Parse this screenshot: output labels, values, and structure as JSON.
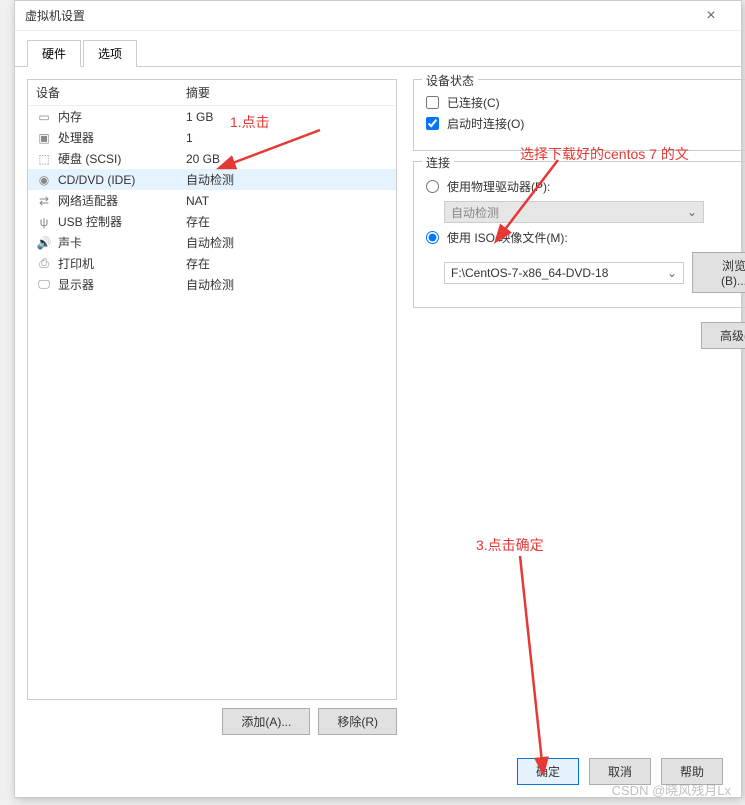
{
  "dialog": {
    "title": "虚拟机设置",
    "tabs": [
      "硬件",
      "选项"
    ],
    "active_tab": 0
  },
  "list": {
    "header_device": "设备",
    "header_summary": "摘要",
    "rows": [
      {
        "icon": "memory-icon",
        "name": "内存",
        "summary": "1 GB"
      },
      {
        "icon": "cpu-icon",
        "name": "处理器",
        "summary": "1"
      },
      {
        "icon": "disk-icon",
        "name": "硬盘 (SCSI)",
        "summary": "20 GB"
      },
      {
        "icon": "disc-icon",
        "name": "CD/DVD (IDE)",
        "summary": "自动检测"
      },
      {
        "icon": "network-icon",
        "name": "网络适配器",
        "summary": "NAT"
      },
      {
        "icon": "usb-icon",
        "name": "USB 控制器",
        "summary": "存在"
      },
      {
        "icon": "sound-icon",
        "name": "声卡",
        "summary": "自动检测"
      },
      {
        "icon": "printer-icon",
        "name": "打印机",
        "summary": "存在"
      },
      {
        "icon": "display-icon",
        "name": "显示器",
        "summary": "自动检测"
      }
    ],
    "selected_index": 3
  },
  "left_buttons": {
    "add": "添加(A)...",
    "remove": "移除(R)"
  },
  "device_status": {
    "group_title": "设备状态",
    "connected_label": "已连接(C)",
    "connected_checked": false,
    "connect_on_label": "启动时连接(O)",
    "connect_on_checked": true
  },
  "connection": {
    "group_title": "连接",
    "physical_label": "使用物理驱动器(P):",
    "physical_selected": false,
    "physical_value": "自动检测",
    "iso_label": "使用 ISO 映像文件(M):",
    "iso_selected": true,
    "iso_value": "F:\\CentOS-7-x86_64-DVD-18",
    "browse": "浏览(B)..."
  },
  "advanced": "高级(V)...",
  "footer": {
    "ok": "确定",
    "cancel": "取消",
    "help": "帮助"
  },
  "annotations": {
    "a1": "1.点击",
    "a2": "选择下载好的centos 7 的文",
    "a3": "3.点击确定"
  },
  "watermark": "CSDN @晓风残月Lx"
}
